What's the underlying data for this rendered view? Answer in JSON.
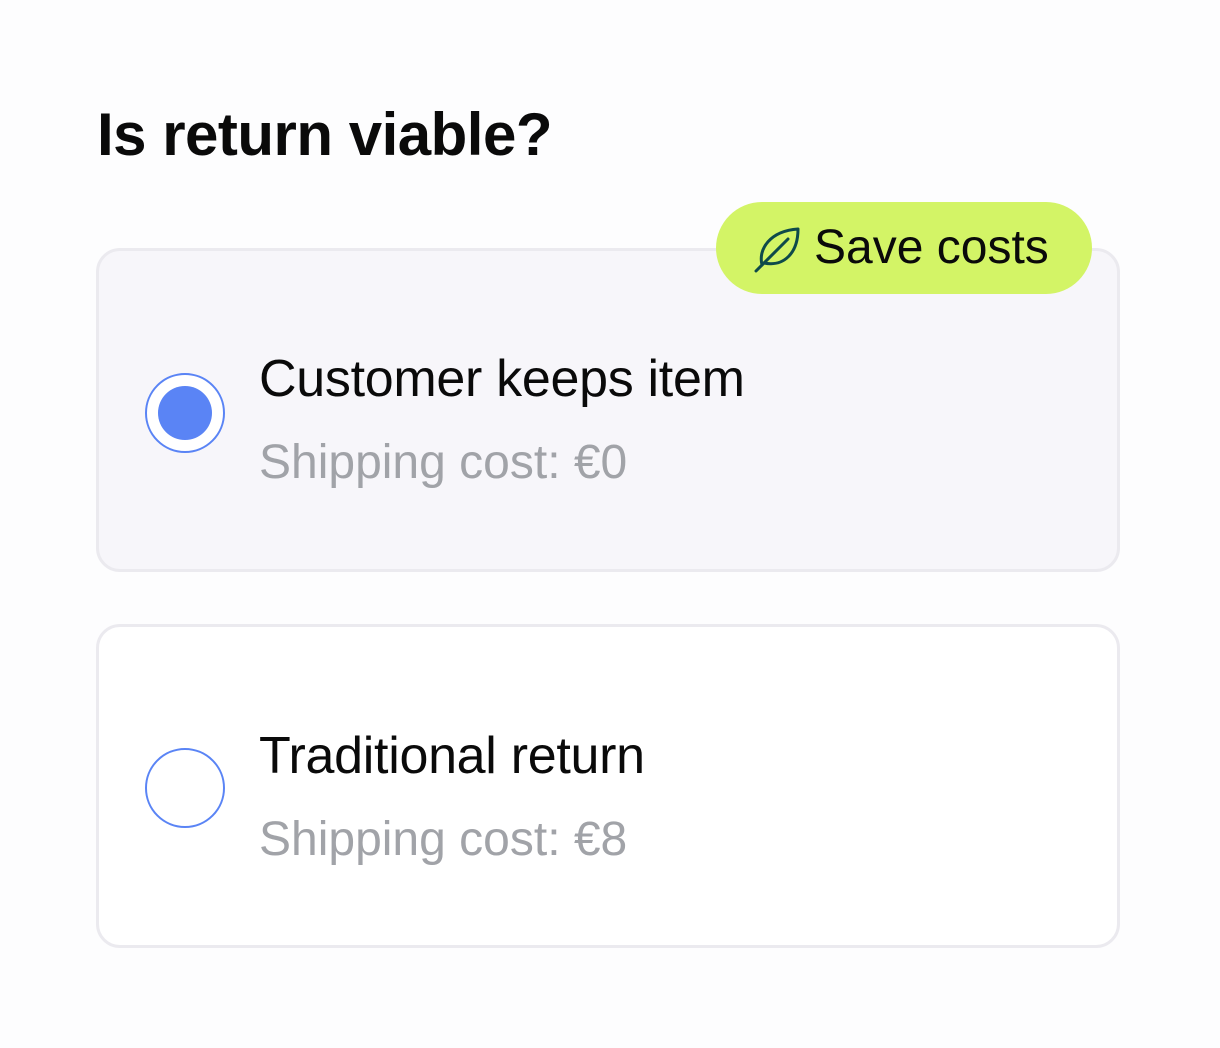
{
  "title": "Is return viable?",
  "badge": {
    "label": "Save costs",
    "icon": "leaf-icon",
    "color": "#d3f466"
  },
  "options": [
    {
      "title": "Customer keeps item",
      "subtitle": "Shipping cost: €0",
      "selected": true
    },
    {
      "title": "Traditional return",
      "subtitle": "Shipping cost: €8",
      "selected": false
    }
  ],
  "colors": {
    "accent": "#5a84f5",
    "muted_text": "#a1a3a8",
    "selected_card_bg": "#f7f6fa"
  }
}
